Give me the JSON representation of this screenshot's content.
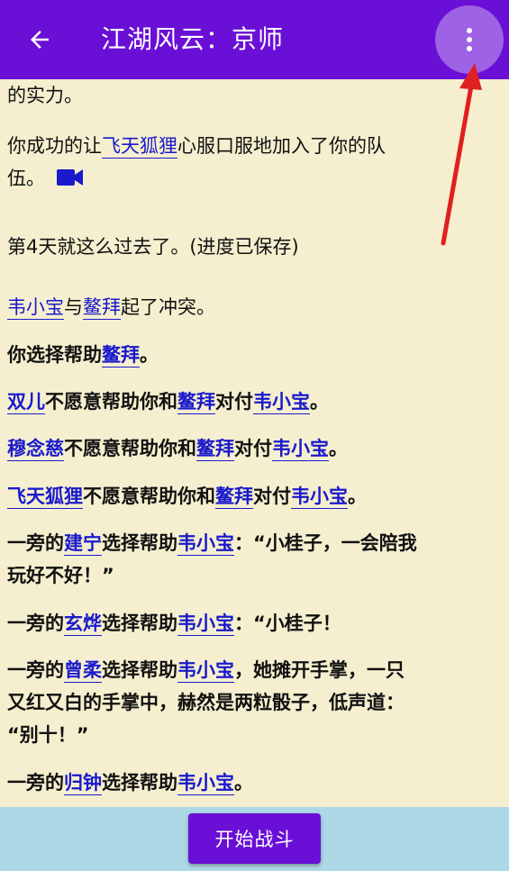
{
  "header": {
    "title": "江湖风云：京师",
    "back_icon": "arrow-left-icon",
    "menu_icon": "more-vert-icon",
    "bg_color": "#6a0fd6"
  },
  "story": {
    "intro_tail": "的实力。",
    "recruit": {
      "prefix": "你成功的让",
      "name": "飞天狐狸",
      "suffix": "心服口服地加入了你的队",
      "line2": "伍。",
      "icon": "video-camera-icon"
    },
    "day_end": "第4天就这么过去了。(进度已保存)",
    "conflict": {
      "a": "韦小宝",
      "mid": "与",
      "b": "鳌拜",
      "suffix": "起了冲突。"
    },
    "choice": {
      "prefix": "你选择帮助",
      "name": "鳌拜",
      "suffix": "。"
    },
    "refusals": [
      {
        "name": "双儿",
        "mid": "不愿意帮助你和",
        "target": "鳌拜",
        "mid2": "对付",
        "enemy": "韦小宝",
        "end": "。"
      },
      {
        "name": "穆念慈",
        "mid": "不愿意帮助你和",
        "target": "鳌拜",
        "mid2": "对付",
        "enemy": "韦小宝",
        "end": "。"
      },
      {
        "name": "飞天狐狸",
        "mid": "不愿意帮助你和",
        "target": "鳌拜",
        "mid2": "对付",
        "enemy": "韦小宝",
        "end": "。"
      }
    ],
    "helper1": {
      "prefix": "一旁的",
      "name": "建宁",
      "mid": "选择帮助",
      "target": "韦小宝",
      "quote1": "：“小桂子，一会陪我",
      "quote2": "玩好不好！”"
    },
    "helper2": {
      "prefix": "一旁的",
      "name": "玄烨",
      "mid": "选择帮助",
      "target": "韦小宝",
      "quote": "：“小桂子！"
    },
    "helper3": {
      "prefix": "一旁的",
      "name": "曾柔",
      "mid": "选择帮助",
      "target": "韦小宝",
      "quote1": "，她摊开手掌，一只",
      "quote2": "又红又白的手掌中，赫然是两粒骰子，低声道：",
      "quote3": "“别十！”"
    },
    "helper4": {
      "prefix": "一旁的",
      "name": "归钟",
      "mid": "选择帮助",
      "target": "韦小宝",
      "end": "。"
    }
  },
  "footer": {
    "start_button": "开始战斗",
    "bg_color": "#add8e6"
  }
}
